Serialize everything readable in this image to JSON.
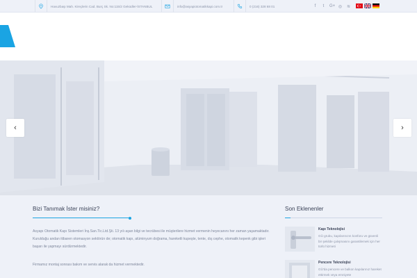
{
  "topbar": {
    "address": "Havuzbaşı Mah. Kireçlerin Cad. Burç Sk. No:115/2 Geküdler-İSTANBUL",
    "email": "info@asyapiotomatikkapi.com.tr",
    "phone": "0 (216) 328 68 01",
    "icons": [
      "location-icon",
      "envelope-icon",
      "phone-icon"
    ],
    "social": [
      {
        "name": "facebook-icon",
        "glyph": "f"
      },
      {
        "name": "twitter-icon",
        "glyph": "t"
      },
      {
        "name": "google-plus-icon",
        "glyph": "G+"
      },
      {
        "name": "instagram-icon",
        "glyph": "◎"
      },
      {
        "name": "rss-icon",
        "glyph": "≋"
      }
    ],
    "flags": [
      "turkish-flag-icon",
      "uk-flag-icon",
      "german-flag-icon"
    ]
  },
  "slider": {
    "prev_glyph": "‹",
    "next_glyph": "›"
  },
  "about": {
    "title": "Bizi Tanımak İster misiniz?",
    "paragraph1": "Asyapı Otomatik Kapı Sistemleri İnş.San.Tic.Ltd.Şti. 13 yılı aşan bilgi ve tecrübesi ile müşterilere hizmet vermenin heyecanını her zaman yaşamaktadır. Kurulduğu andan itibaren otomasyon sektörün de; otomatik kapı, alüminyum doğrama, hareketli kupeşte, tente, dış cephe, otomatik kepenk gibi işleri başarı ile yapmayı sürdürmektedir.",
    "paragraph2": "Firmamız montaj sonrası bakım ve servis alarak da hizmet vermektedir."
  },
  "recent": {
    "title": "Son Eklenenler",
    "items": [
      {
        "title": "Kapı Teknolojisi",
        "desc": "GÜ grubu, kapılarınızın konforu ve güvenli bir şekilde çalışmasını garantilemek için her türlü hizmeti"
      },
      {
        "title": "Pencere Teknolojisi",
        "desc": "GÜ'da pencere ve balkon kapılarınız hareket ettirmek veya emniyete"
      }
    ]
  },
  "colors": {
    "accent": "#1aa4e3",
    "background": "#eef1f8"
  }
}
